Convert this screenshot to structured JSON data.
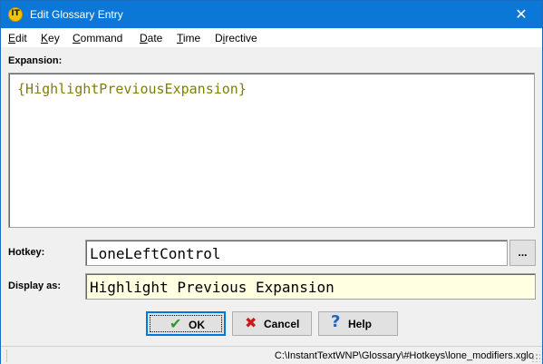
{
  "window": {
    "title": "Edit Glossary Entry",
    "app_icon_text": "IT",
    "close_symbol": "✕"
  },
  "menu": {
    "items": [
      {
        "label": "Edit",
        "access_key": "E"
      },
      {
        "label": "Key",
        "access_key": "K"
      },
      {
        "label": "Command",
        "access_key": "C"
      },
      {
        "label": "Date",
        "access_key": "D"
      },
      {
        "label": "Time",
        "access_key": "T"
      },
      {
        "label": "Directive",
        "access_key": "i"
      }
    ]
  },
  "form": {
    "expansion_label": "Expansion:",
    "expansion_value": "{HighlightPreviousExpansion}",
    "hotkey_label": "Hotkey:",
    "hotkey_value": "LoneLeftControl",
    "browse_label": "...",
    "display_label": "Display as:",
    "display_value": "Highlight Previous Expansion"
  },
  "buttons": {
    "ok": {
      "label": "OK",
      "icon": "checkmark-icon",
      "icon_color": "#2e9a2e"
    },
    "cancel": {
      "label": "Cancel",
      "icon": "x-icon",
      "icon_color": "#cc1a1a"
    },
    "help": {
      "label": "Help",
      "icon": "question-icon",
      "icon_color": "#1d64c8"
    }
  },
  "status": {
    "path": "C:\\InstantTextWNP\\Glossary\\#Hotkeys\\lone_modifiers.xglo"
  },
  "colors": {
    "titlebar": "#0b78d7",
    "expansion_text": "#808000",
    "display_bg": "#ffffe1"
  }
}
